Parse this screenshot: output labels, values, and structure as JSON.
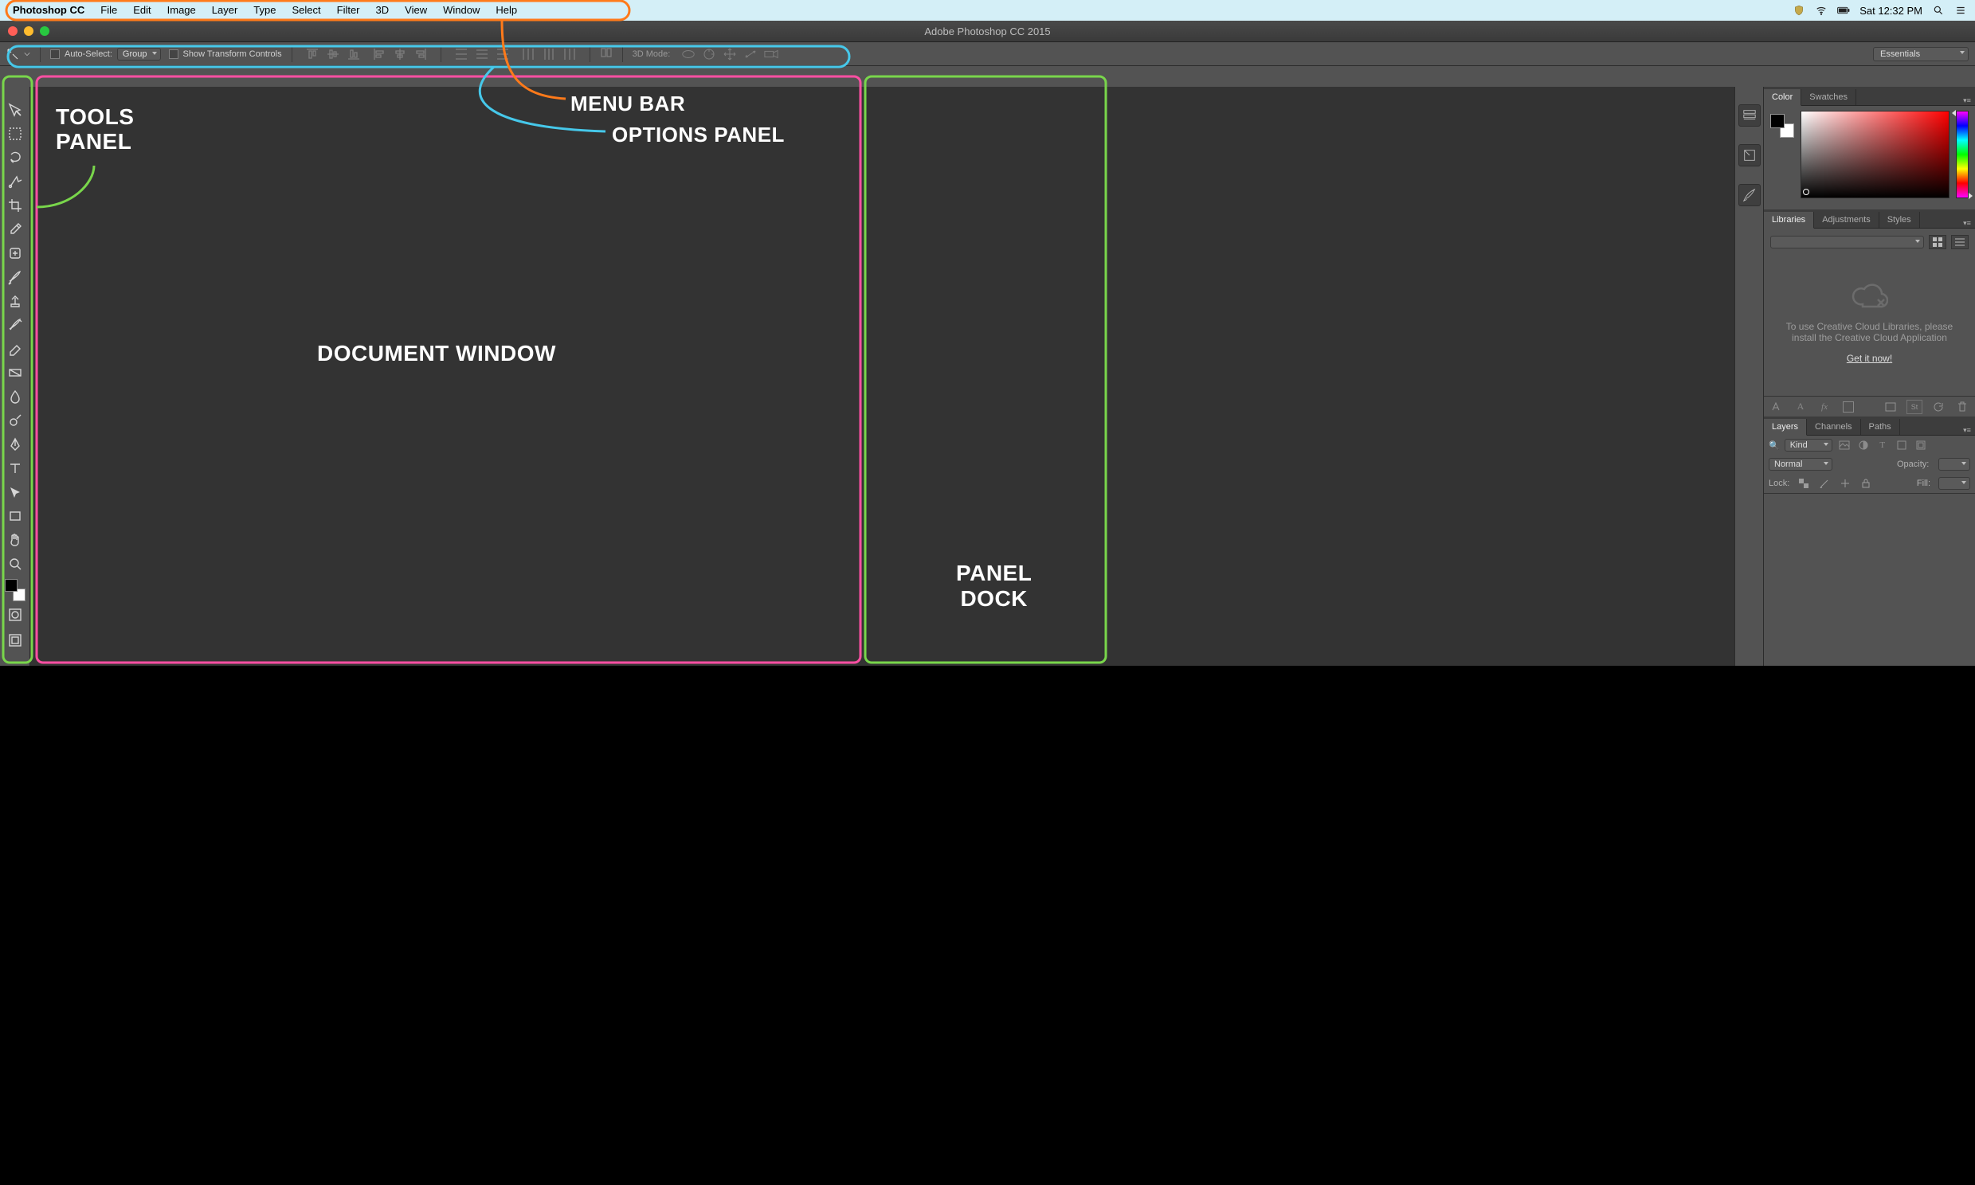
{
  "mac": {
    "app_name": "Photoshop CC",
    "menus": [
      "File",
      "Edit",
      "Image",
      "Layer",
      "Type",
      "Select",
      "Filter",
      "3D",
      "View",
      "Window",
      "Help"
    ],
    "clock": "Sat 12:32 PM"
  },
  "window": {
    "title": "Adobe Photoshop CC 2015"
  },
  "options": {
    "auto_select_label": "Auto-Select:",
    "auto_select_value": "Group",
    "show_transform_label": "Show Transform Controls",
    "mode_3d_label": "3D Mode:"
  },
  "workspace": {
    "current": "Essentials"
  },
  "tools": [
    {
      "name": "move-tool"
    },
    {
      "name": "marquee-tool"
    },
    {
      "name": "lasso-tool"
    },
    {
      "name": "quick-select-tool"
    },
    {
      "name": "crop-tool"
    },
    {
      "name": "eyedropper-tool"
    },
    {
      "name": "healing-brush-tool"
    },
    {
      "name": "brush-tool"
    },
    {
      "name": "clone-stamp-tool"
    },
    {
      "name": "history-brush-tool"
    },
    {
      "name": "eraser-tool"
    },
    {
      "name": "gradient-tool"
    },
    {
      "name": "blur-tool"
    },
    {
      "name": "dodge-tool"
    },
    {
      "name": "pen-tool"
    },
    {
      "name": "type-tool"
    },
    {
      "name": "path-select-tool"
    },
    {
      "name": "rectangle-tool"
    },
    {
      "name": "hand-tool"
    },
    {
      "name": "zoom-tool"
    }
  ],
  "bottom_tools": [
    {
      "name": "quick-mask-tool"
    },
    {
      "name": "screen-mode-tool"
    }
  ],
  "panels": {
    "color": {
      "tabs": [
        "Color",
        "Swatches"
      ],
      "active": 0
    },
    "libraries": {
      "tabs": [
        "Libraries",
        "Adjustments",
        "Styles"
      ],
      "active": 0,
      "message": "To use Creative Cloud Libraries, please install the Creative Cloud Application",
      "cta": "Get it now!"
    },
    "layers": {
      "tabs": [
        "Layers",
        "Channels",
        "Paths"
      ],
      "active": 0,
      "filter_kind": "Kind",
      "blend_mode": "Normal",
      "opacity_label": "Opacity:",
      "lock_label": "Lock:",
      "fill_label": "Fill:"
    }
  },
  "callouts": {
    "menu_bar": "MENU BAR",
    "options_panel": "OPTIONS PANEL",
    "tools_panel_l1": "TOOLS",
    "tools_panel_l2": "PANEL",
    "document_window": "DOCUMENT WINDOW",
    "panel_dock_l1": "PANEL",
    "panel_dock_l2": "DOCK"
  },
  "colors": {
    "menu_highlight": "#ff7a1a",
    "options_highlight": "#46c8ea",
    "tools_highlight": "#79d64b",
    "doc_highlight": "#ff4fa3",
    "dock_highlight": "#79d64b"
  }
}
